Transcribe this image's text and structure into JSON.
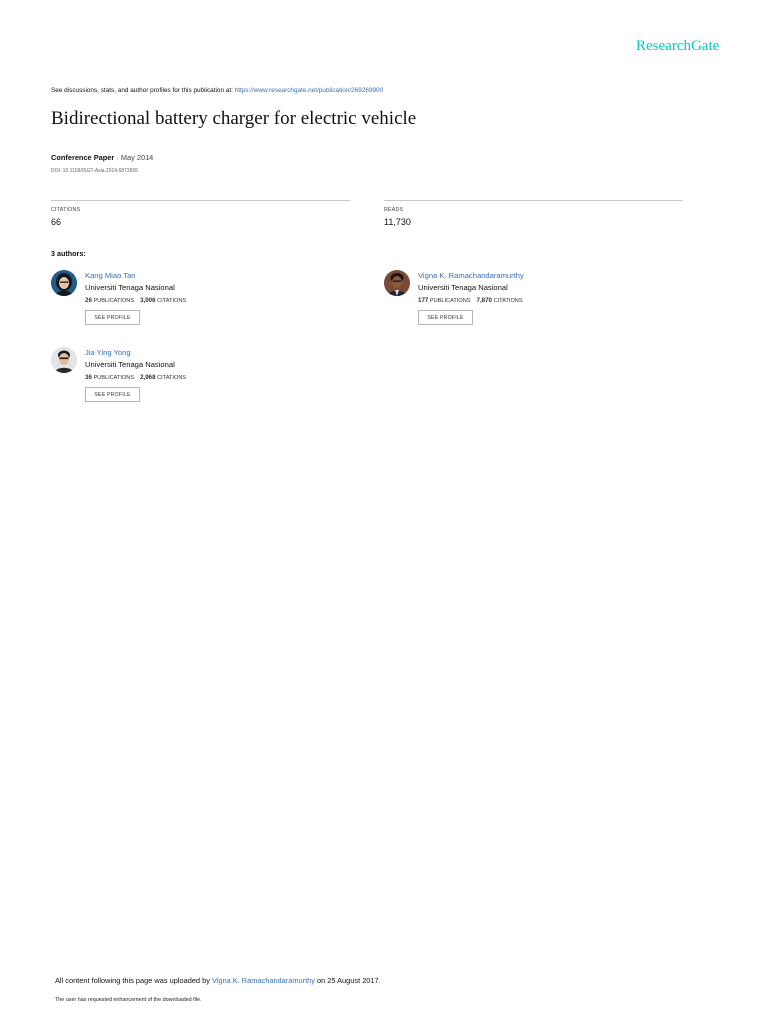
{
  "header": {
    "logo_text": "ResearchGate",
    "discussion_prefix": "See discussions, stats, and author profiles for this publication at: ",
    "publication_url": "https://www.researchgate.net/publication/269269900"
  },
  "publication": {
    "title": "Bidirectional battery charger for electric vehicle",
    "type": "Conference Paper",
    "date": " · May 2014",
    "doi": "DOI: 10.1109/ISGT-Asia.2014.6873826"
  },
  "stats": {
    "citations_label": "CITATIONS",
    "citations_value": "66",
    "reads_label": "READS",
    "reads_value": "11,730"
  },
  "authors_heading": "3 authors:",
  "authors": [
    {
      "name": "Kang Miao Tan",
      "institution": "Universiti Tenaga Nasional",
      "publications": "26",
      "publications_label": "PUBLICATIONS",
      "citations": "3,006",
      "citations_label": "CITATIONS",
      "button_label": "SEE PROFILE"
    },
    {
      "name": "Vigna K. Ramachandaramurthy",
      "institution": "Universiti Tenaga Nasional",
      "publications": "177",
      "publications_label": "PUBLICATIONS",
      "citations": "7,870",
      "citations_label": "CITATIONS",
      "button_label": "SEE PROFILE"
    },
    {
      "name": "Jia Ying Yong",
      "institution": "Universiti Tenaga Nasional",
      "publications": "36",
      "publications_label": "PUBLICATIONS",
      "citations": "2,968",
      "citations_label": "CITATIONS",
      "button_label": "SEE PROFILE"
    }
  ],
  "footer": {
    "upload_prefix": "All content following this page was uploaded by ",
    "uploader": "Vigna K. Ramachandaramurthy",
    "upload_suffix": " on 25 August 2017.",
    "note": "The user has requested enhancement of the downloaded file."
  },
  "colors": {
    "brand": "#00ccbb",
    "link": "#3a6fb0"
  }
}
